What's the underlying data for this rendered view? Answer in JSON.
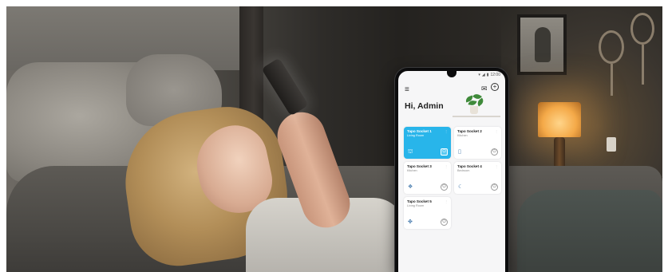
{
  "app": {
    "status": {
      "time": "12:00"
    },
    "greeting": "Hi, Admin",
    "devices": [
      {
        "name": "Tapo Socket 1",
        "room": "Living Room",
        "icon": "lamp-icon",
        "on": true
      },
      {
        "name": "Tapo Socket 2",
        "room": "Kitchen",
        "icon": "kettle-icon",
        "on": false
      },
      {
        "name": "Tapo Socket 3",
        "room": "Kitchen",
        "icon": "appliance-icon",
        "on": false
      },
      {
        "name": "Tapo Socket 4",
        "room": "Bedroom",
        "icon": "heater-icon",
        "on": false
      },
      {
        "name": "Tapo Socket 5",
        "room": "Living Room",
        "icon": "fan-icon",
        "on": false
      }
    ]
  },
  "colors": {
    "accent": "#28b5ea",
    "card": "#ffffff",
    "screen_bg": "#f6f6f7"
  }
}
